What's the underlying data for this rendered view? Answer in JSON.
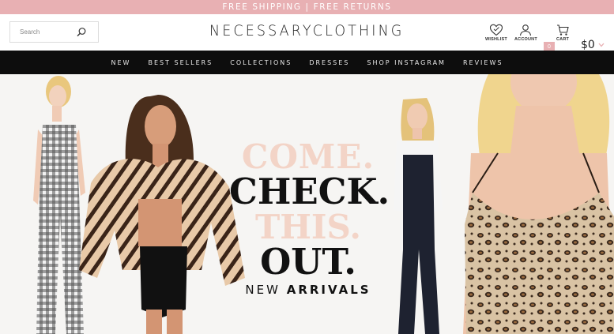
{
  "promo": {
    "text": "FREE SHIPPING | FREE RETURNS"
  },
  "header": {
    "search_placeholder": "Search",
    "logo": "NECESSARYCLOTHING",
    "wishlist_label": "WISHLIST",
    "account_label": "ACCOUNT",
    "cart_label": "CART",
    "cart_count": "0",
    "cart_total": "$0"
  },
  "nav": {
    "items": [
      {
        "label": "NEW"
      },
      {
        "label": "BEST SELLERS"
      },
      {
        "label": "COLLECTIONS"
      },
      {
        "label": "DRESSES"
      },
      {
        "label": "SHOP INSTAGRAM"
      },
      {
        "label": "REVIEWS"
      }
    ]
  },
  "hero": {
    "line1": "COME.",
    "line2": "CHECK.",
    "line3": "THIS.",
    "line4": "OUT.",
    "tag_prefix": "NEW",
    "tag_main": "ARRIVALS"
  },
  "colors": {
    "promo_bg": "#e8b0b3",
    "nav_bg": "#0d0d0d",
    "hero_accent": "#f3d4c7"
  }
}
